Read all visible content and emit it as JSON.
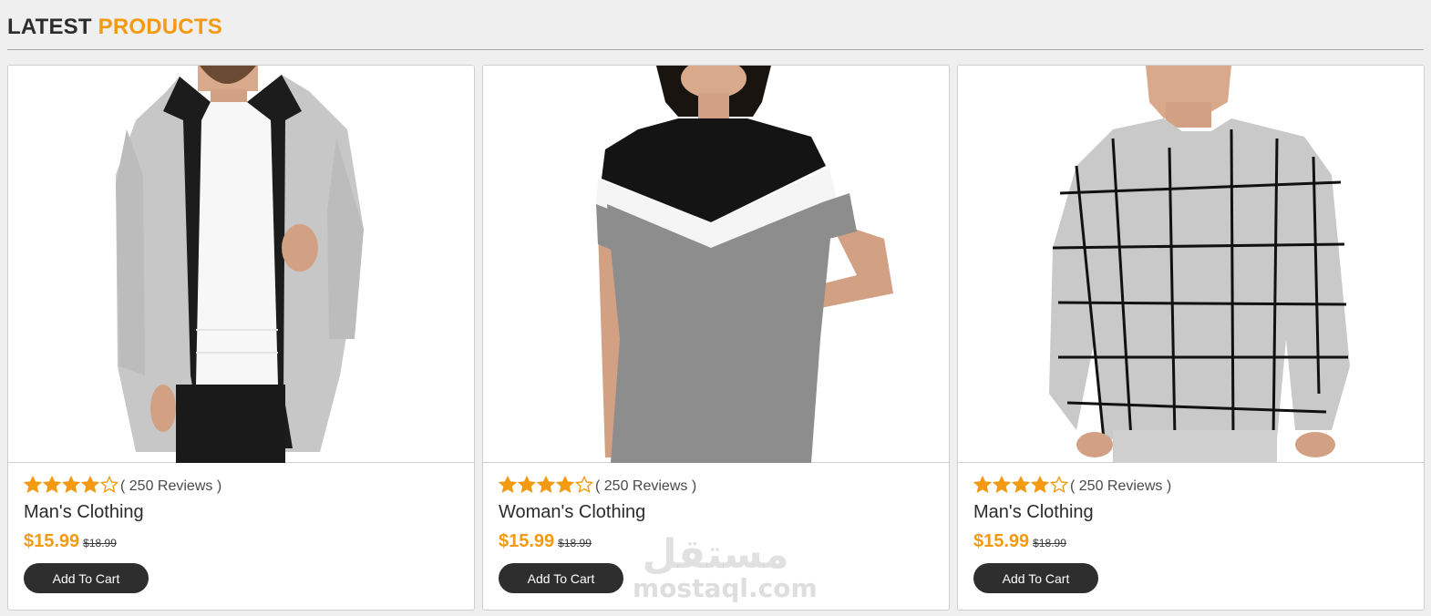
{
  "section": {
    "title_main": "LATEST",
    "title_accent": "PRODUCTS"
  },
  "colors": {
    "accent": "#f39a12",
    "button_bg": "#2e2e2e",
    "star": "#f39a12"
  },
  "products": [
    {
      "image": "man-cardigan-photo",
      "rating": 4,
      "rating_max": 5,
      "reviews": "( 250 Reviews )",
      "name": "Man's Clothing",
      "price": "$15.99",
      "old_price": "$18.99",
      "cta": "Add To Cart"
    },
    {
      "image": "woman-tshirt-dress-photo",
      "rating": 4,
      "rating_max": 5,
      "reviews": "( 250 Reviews )",
      "name": "Woman's Clothing",
      "price": "$15.99",
      "old_price": "$18.99",
      "cta": "Add To Cart"
    },
    {
      "image": "man-grid-sweater-photo",
      "rating": 4,
      "rating_max": 5,
      "reviews": "( 250 Reviews )",
      "name": "Man's Clothing",
      "price": "$15.99",
      "old_price": "$18.99",
      "cta": "Add To Cart"
    }
  ],
  "watermark": {
    "arabic": "مستقل",
    "latin": "mostaql.com"
  }
}
